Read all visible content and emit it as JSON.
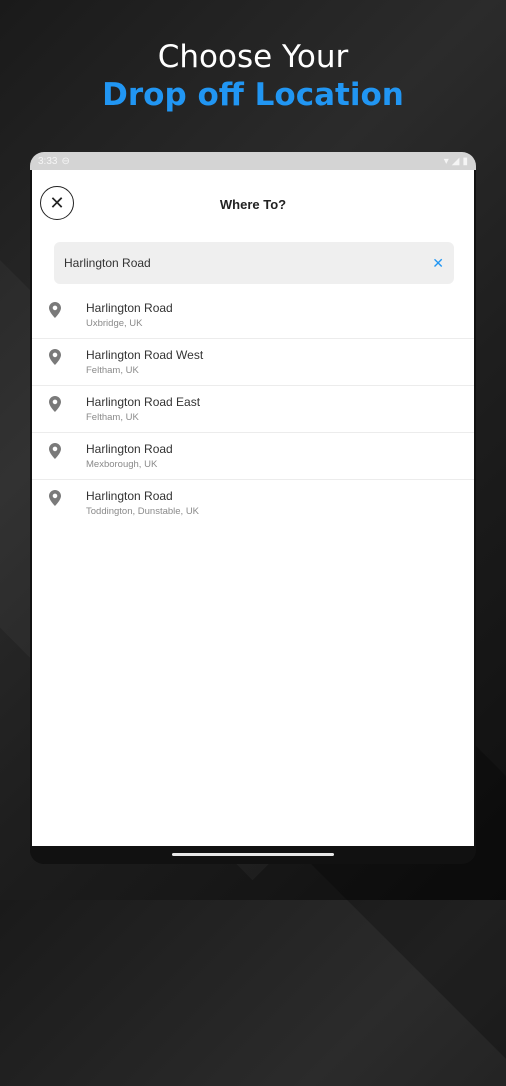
{
  "headline": {
    "line1": "Choose Your",
    "line2": "Drop off Location"
  },
  "statusbar": {
    "time": "3:33"
  },
  "screen": {
    "title": "Where To?",
    "search": {
      "value": "Harlington Road",
      "clear_icon": "close-icon"
    },
    "results": [
      {
        "name": "Harlington Road",
        "sub": "Uxbridge, UK"
      },
      {
        "name": "Harlington Road West",
        "sub": "Feltham, UK"
      },
      {
        "name": "Harlington Road East",
        "sub": "Feltham, UK"
      },
      {
        "name": "Harlington Road",
        "sub": "Mexborough, UK"
      },
      {
        "name": "Harlington Road",
        "sub": "Toddington, Dunstable, UK"
      }
    ]
  },
  "colors": {
    "accent": "#2196f3",
    "background": "#1e1e1e"
  }
}
